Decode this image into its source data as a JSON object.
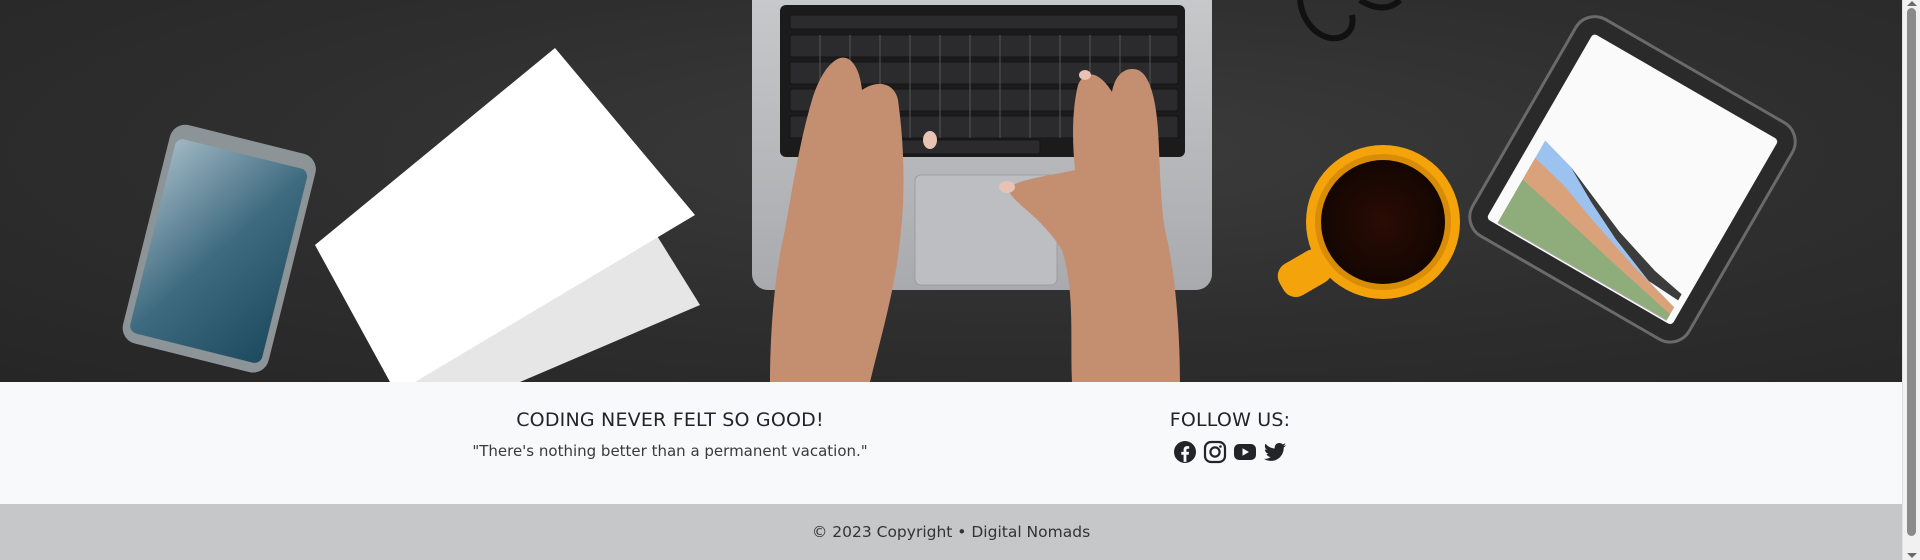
{
  "hero": {
    "image": "desk-top-view-laptop-typing-tablet-coffee-photo"
  },
  "footer": {
    "left": {
      "heading": "CODING NEVER FELT SO GOOD!",
      "quote": "\"There's nothing better than a permanent vacation.\""
    },
    "right": {
      "heading": "FOLLOW US:",
      "social_icons": [
        "facebook-icon",
        "instagram-icon",
        "youtube-icon",
        "twitter-icon"
      ]
    },
    "copyright": "© 2023 Copyright • Digital Nomads"
  },
  "colors": {
    "hero_background": "#2e2e2e",
    "footer_background": "#f8f9fa",
    "copyright_background": "#c6c7c8",
    "text": "#212529",
    "icon": "#212529",
    "coffee_cup": "#f5a30a"
  }
}
